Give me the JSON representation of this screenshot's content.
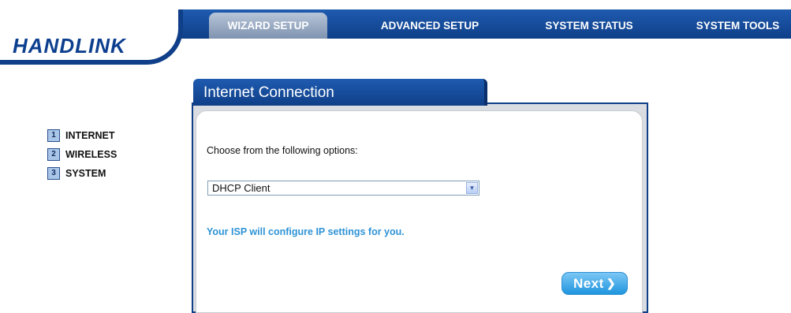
{
  "brand": {
    "logo_text": "HANDLINK"
  },
  "nav": {
    "tabs": [
      {
        "label": "WIZARD SETUP",
        "active": true
      },
      {
        "label": "ADVANCED SETUP",
        "active": false
      },
      {
        "label": "SYSTEM STATUS",
        "active": false
      },
      {
        "label": "SYSTEM TOOLS",
        "active": false
      }
    ]
  },
  "steps": [
    {
      "num": "1",
      "label": "INTERNET"
    },
    {
      "num": "2",
      "label": "WIRELESS"
    },
    {
      "num": "3",
      "label": "SYSTEM"
    }
  ],
  "panel": {
    "title": "Internet Connection",
    "prompt": "Choose from the following options:",
    "connection_select": {
      "value": "DHCP Client"
    },
    "hint": "Your ISP will configure IP settings for you.",
    "next_label": "Next",
    "next_icon": "chevron-right-icon"
  },
  "colors": {
    "brand_blue": "#0f3f88",
    "hint_blue": "#2e93d6",
    "button_blue": "#1f95de"
  }
}
